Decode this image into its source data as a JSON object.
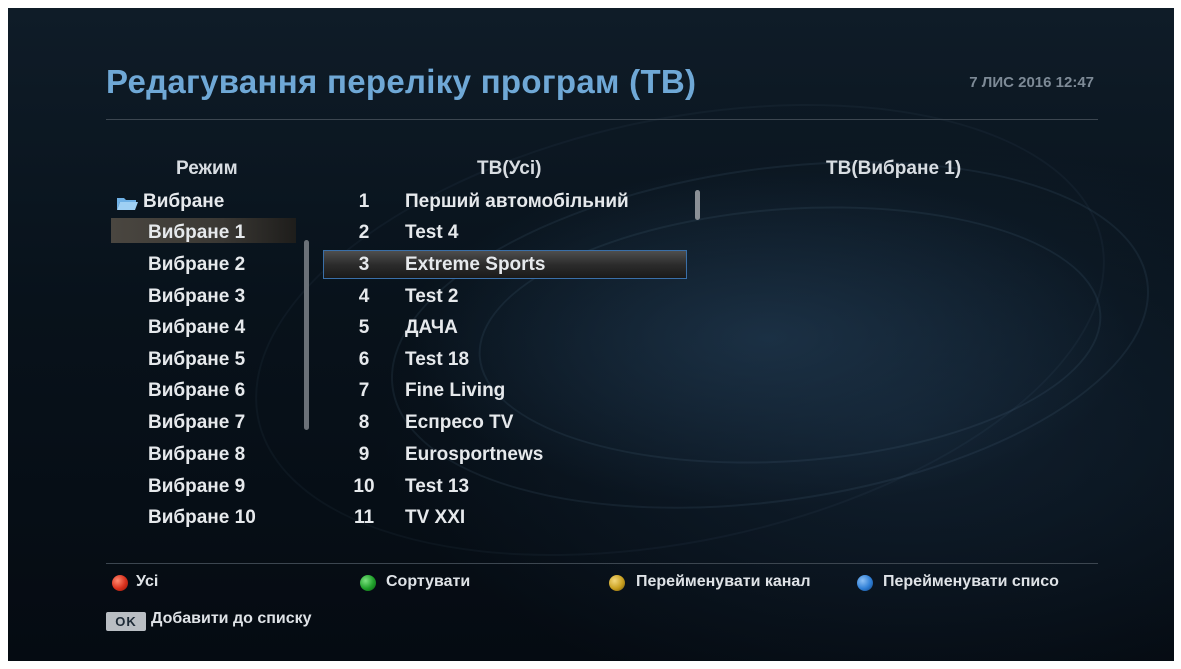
{
  "header": {
    "title": "Редагування переліку програм (ТВ)",
    "datetime": "7 ЛИС 2016 12:47"
  },
  "mode_column": {
    "header": "Режим",
    "folder_label": "Вибране",
    "items": [
      "Вибране 1",
      "Вибране 2",
      "Вибране 3",
      "Вибране 4",
      "Вибране 5",
      "Вибране 6",
      "Вибране 7",
      "Вибране 8",
      "Вибране 9",
      "Вибране 10"
    ],
    "selected_index": 0
  },
  "channel_column": {
    "header": "ТВ(Усі)",
    "channels": [
      {
        "num": "1",
        "name": "Перший автомобільний"
      },
      {
        "num": "2",
        "name": "Test 4"
      },
      {
        "num": "3",
        "name": "Extreme Sports"
      },
      {
        "num": "4",
        "name": "Test 2"
      },
      {
        "num": "5",
        "name": "ДАЧА"
      },
      {
        "num": "6",
        "name": "Test 18"
      },
      {
        "num": "7",
        "name": "Fine Living"
      },
      {
        "num": "8",
        "name": "Еспресо TV"
      },
      {
        "num": "9",
        "name": "Eurosportnews"
      },
      {
        "num": "10",
        "name": "Test 13"
      },
      {
        "num": "11",
        "name": "TV XXI"
      }
    ],
    "selected_index": 2
  },
  "favorites_column": {
    "header": "ТВ(Вибране 1)"
  },
  "footer": {
    "red": {
      "label": "Усі",
      "color": "#e0301e"
    },
    "green": {
      "label": "Сортувати",
      "color": "#1fa02a"
    },
    "yellow": {
      "label": "Перейменувати канал",
      "color": "#c9a020"
    },
    "blue": {
      "label": "Перейменувати списо",
      "color": "#2f7fd6"
    },
    "ok_key": "OK",
    "ok_label": "Добавити до списку"
  }
}
